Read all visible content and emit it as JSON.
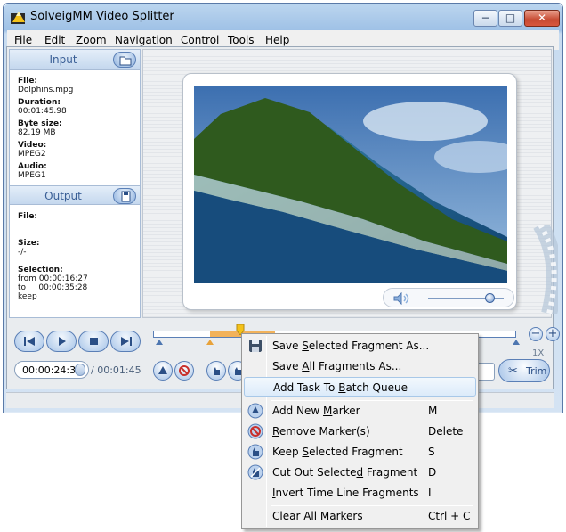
{
  "window": {
    "title": "SolveigMM Video Splitter",
    "buttons": {
      "minimize": "−",
      "maximize": "□",
      "close": "✕"
    }
  },
  "menu": [
    "File",
    "Edit",
    "Zoom",
    "Navigation",
    "Control",
    "Tools",
    "Help"
  ],
  "input_panel": {
    "title": "Input",
    "file_label": "File:",
    "file_value": "Dolphins.mpg",
    "duration_label": "Duration:",
    "duration_value": "00:01:45.98",
    "size_label": "Byte size:",
    "size_value": "82.19 MB",
    "video_label": "Video:",
    "video_value": "MPEG2",
    "audio_label": "Audio:",
    "audio_value": "MPEG1"
  },
  "output_panel": {
    "title": "Output",
    "file_label": "File:",
    "file_value": "",
    "size_label": "Size:",
    "size_value": "-/-",
    "selection_label": "Selection:",
    "from_label": "from",
    "from_value": "00:00:16:27",
    "to_label": "to",
    "to_value": "00:00:35:28",
    "mode_value": "keep"
  },
  "transport": {
    "current_time": "00:00:24:34",
    "total_time": "/ 00:01:45"
  },
  "timeline": {
    "zoom_label": "1X",
    "zoom_out": "−",
    "zoom_in": "+",
    "position_fraction": 0.24,
    "selection_start_fraction": 0.155,
    "selection_end_fraction": 0.335
  },
  "trim_button": "Trim",
  "context_menu": {
    "items": [
      {
        "label_pre": "Save ",
        "label_u": "S",
        "label_post": "elected Fragment As...",
        "key": "",
        "icon": "floppy-icon"
      },
      {
        "label_pre": "Save ",
        "label_u": "A",
        "label_post": "ll Fragments As...",
        "key": "",
        "icon": ""
      },
      {
        "label_pre": "Add Task To ",
        "label_u": "B",
        "label_post": "atch Queue",
        "key": "",
        "icon": ""
      },
      {
        "label_pre": "Add New ",
        "label_u": "M",
        "label_post": "arker",
        "key": "M",
        "icon": "add-marker-icon"
      },
      {
        "label_pre": "",
        "label_u": "R",
        "label_post": "emove Marker(s)",
        "key": "Delete",
        "icon": "remove-marker-icon"
      },
      {
        "label_pre": "Keep ",
        "label_u": "S",
        "label_post": "elected Fragment",
        "key": "S",
        "icon": "keep-fragment-icon"
      },
      {
        "label_pre": "Cut Out Selecte",
        "label_u": "d",
        "label_post": " Fragment",
        "key": "D",
        "icon": "cut-fragment-icon"
      },
      {
        "label_pre": "",
        "label_u": "I",
        "label_post": "nvert Time Line Fragments",
        "key": "I",
        "icon": ""
      },
      {
        "label_pre": "Clear All Markers",
        "label_u": "",
        "label_post": "",
        "key": "Ctrl + C",
        "icon": ""
      }
    ]
  },
  "colors": {
    "accent": "#5a7fb6",
    "selection_segment": "#f2b25a",
    "menu_highlight": "#dcebfa"
  }
}
